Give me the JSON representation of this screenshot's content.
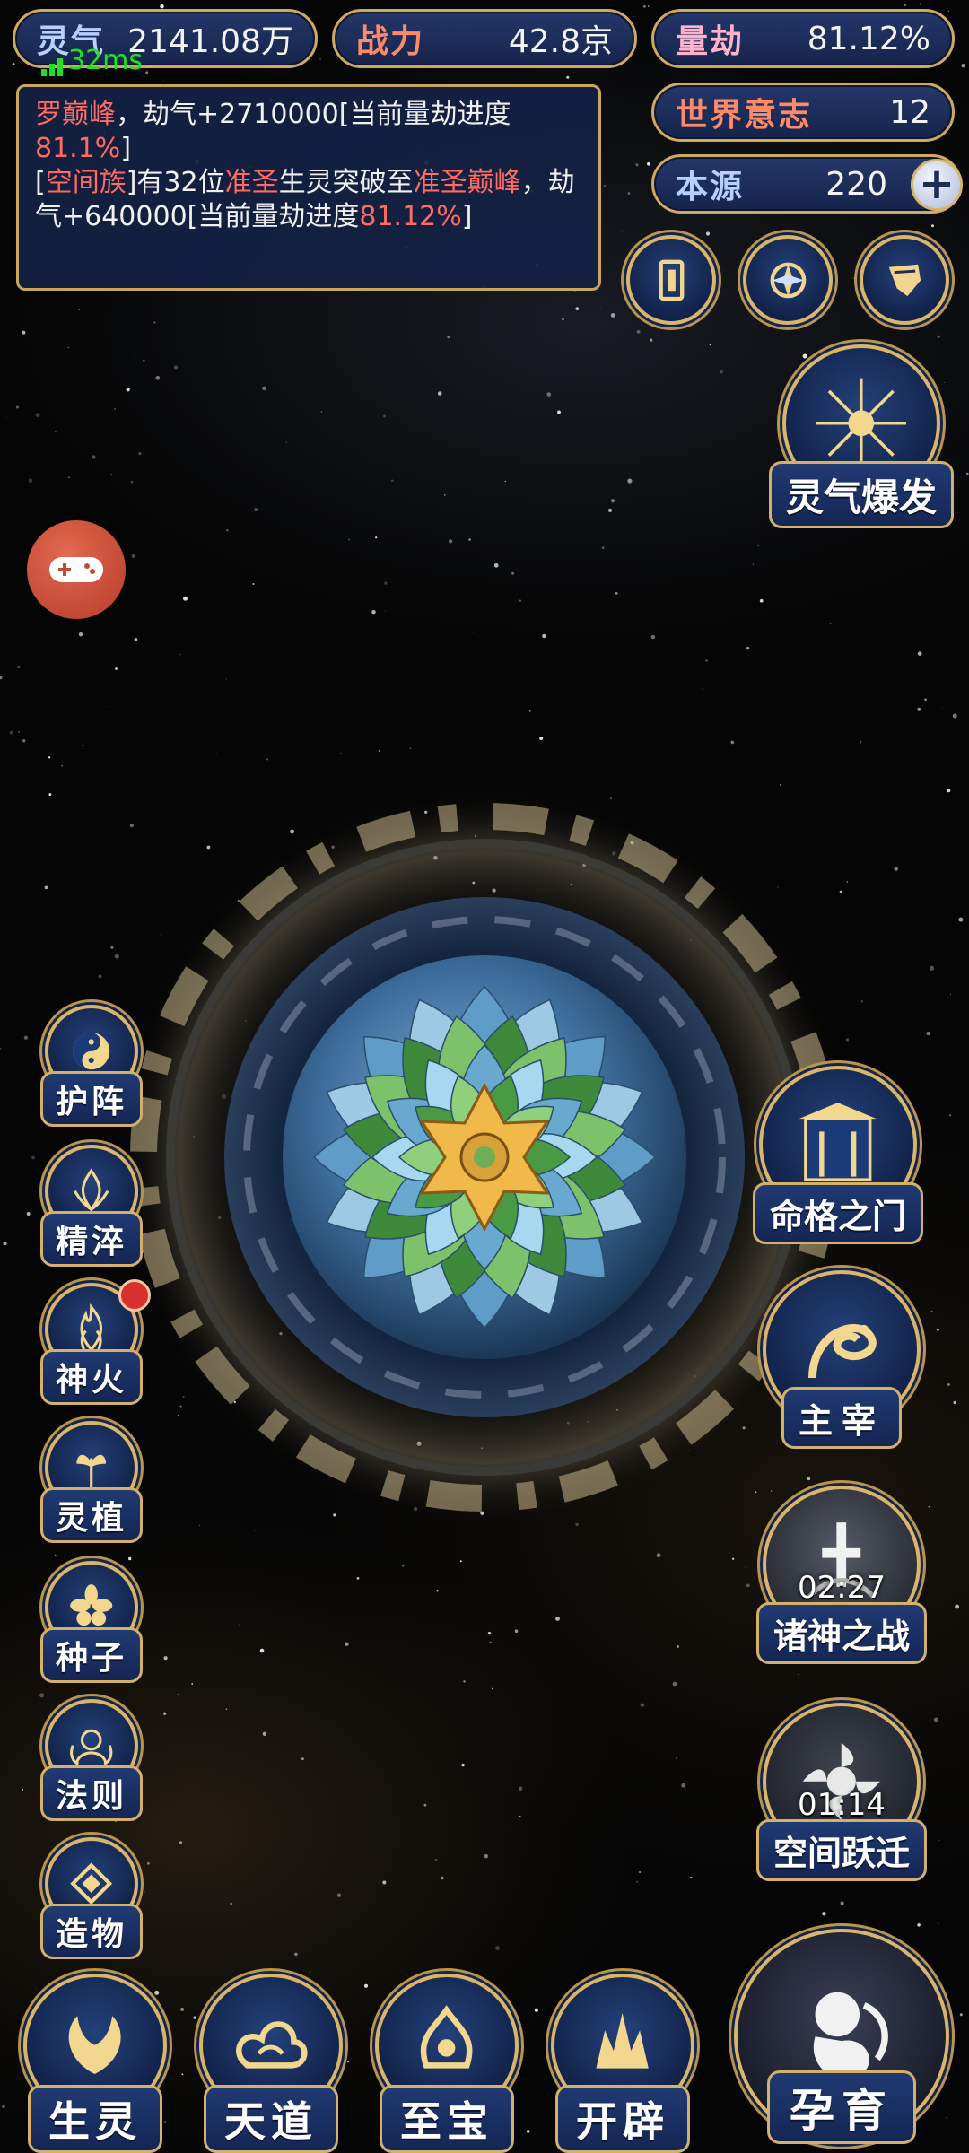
{
  "stats": {
    "lingqi": {
      "label": "灵气",
      "value": "2141.08万"
    },
    "power": {
      "label": "战力",
      "value": "42.8京"
    },
    "calamity": {
      "label": "量劫",
      "value": "81.12%"
    },
    "world_will": {
      "label": "世界意志",
      "value": "12"
    },
    "origin": {
      "label": "本源",
      "value": "220"
    }
  },
  "ping": "32ms",
  "messages": [
    {
      "name_red": "罗巅峰",
      "text": "，劫气+2710000[当前量劫进度",
      "progress": "81.1%",
      "tail": "]"
    },
    {
      "prefix": "[",
      "faction_red": "空间族",
      "text1": "]有32位",
      "rank_red": "准圣",
      "text2": "生灵突破至",
      "rank2_red": "准圣巅峰",
      "text3": "，劫气+640000[当前量劫进度",
      "progress": "81.12%",
      "tail": "]"
    }
  ],
  "top_right_icons": [
    "card-icon",
    "vortex-icon",
    "scroll-icon"
  ],
  "burst": {
    "label": "灵气爆发"
  },
  "left_menu": [
    {
      "label": "护阵",
      "icon": "yin-yang-icon",
      "badge": false
    },
    {
      "label": "精淬",
      "icon": "flame-lotus-icon",
      "badge": false
    },
    {
      "label": "神火",
      "icon": "fire-icon",
      "badge": true
    },
    {
      "label": "灵植",
      "icon": "plant-icon",
      "badge": false
    },
    {
      "label": "种子",
      "icon": "seed-flower-icon",
      "badge": false
    },
    {
      "label": "法则",
      "icon": "rule-beast-icon",
      "badge": false
    },
    {
      "label": "造物",
      "icon": "creation-icon",
      "badge": false
    }
  ],
  "right_menu": [
    {
      "label": "命格之门",
      "icon": "gate-icon",
      "timer": ""
    },
    {
      "label": "主宰",
      "icon": "dragon-icon",
      "timer": ""
    },
    {
      "label": "诸神之战",
      "icon": "sword-icon",
      "timer": "02:27"
    },
    {
      "label": "空间跃迁",
      "icon": "portal-icon",
      "timer": "01:14"
    }
  ],
  "bottom_menu": [
    {
      "label": "生灵",
      "icon": "phoenix-icon"
    },
    {
      "label": "天道",
      "icon": "cloud-icon"
    },
    {
      "label": "至宝",
      "icon": "treasure-icon"
    },
    {
      "label": "开辟",
      "icon": "creation-flame-icon"
    }
  ],
  "breed": {
    "label": "孕育",
    "icon": "embryo-icon"
  },
  "colors": {
    "gold": "#d9b56c",
    "navy": "#1a2c5c",
    "red_text": "#ff6b62",
    "ping_green": "#1fe21f"
  }
}
